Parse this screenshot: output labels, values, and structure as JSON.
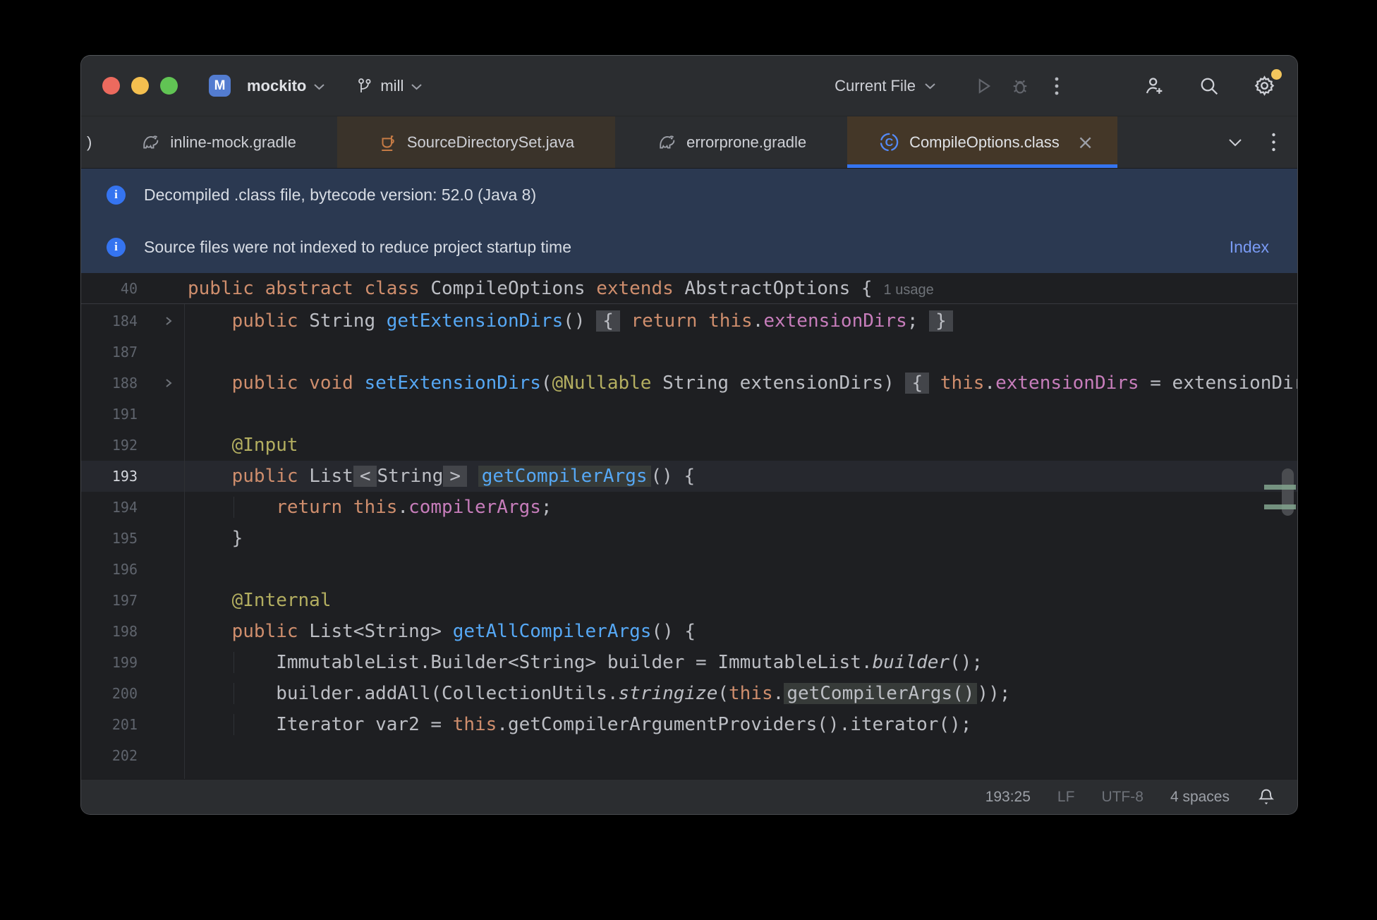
{
  "titlebar": {
    "project_initial": "M",
    "project": "mockito",
    "branch": "mill",
    "run_config": "Current File"
  },
  "tabs": {
    "overflow_left": ")",
    "items": [
      {
        "label": "inline-mock.gradle",
        "icon": "gradle-icon",
        "state": "normal"
      },
      {
        "label": "SourceDirectorySet.java",
        "icon": "java-icon",
        "state": "library"
      },
      {
        "label": "errorprone.gradle",
        "icon": "gradle-icon",
        "state": "normal"
      },
      {
        "label": "CompileOptions.class",
        "icon": "class-icon",
        "state": "active",
        "close": "×"
      }
    ]
  },
  "banners": [
    {
      "icon": "info-icon",
      "text": "Decompiled .class file, bytecode version: 52.0 (Java 8)",
      "action": ""
    },
    {
      "icon": "info-icon",
      "text": "Source files were not indexed to reduce project startup time",
      "action": "Index"
    }
  ],
  "editor": {
    "sticky": {
      "num": "40",
      "segs": [
        [
          "kw",
          "public abstract class "
        ],
        [
          "tx",
          "CompileOptions "
        ],
        [
          "kw",
          "extends "
        ],
        [
          "tx",
          "AbstractOptions {"
        ],
        [
          "inlay",
          "1 usage"
        ]
      ]
    },
    "lines": [
      {
        "num": "184",
        "fold": true,
        "segs": [
          [
            "kw",
            "    public "
          ],
          [
            "tx",
            "String "
          ],
          [
            "m",
            "getExtensionDirs"
          ],
          [
            "tx",
            "() "
          ],
          [
            "box",
            "{"
          ],
          [
            "tx",
            " "
          ],
          [
            "kw",
            "return this"
          ],
          [
            "tx",
            "."
          ],
          [
            "f",
            "extensionDirs"
          ],
          [
            "tx",
            "; "
          ],
          [
            "box",
            "}"
          ]
        ]
      },
      {
        "num": "187",
        "segs": []
      },
      {
        "num": "188",
        "fold": true,
        "segs": [
          [
            "kw",
            "    public void "
          ],
          [
            "m",
            "setExtensionDirs"
          ],
          [
            "tx",
            "("
          ],
          [
            "ann",
            "@Nullable"
          ],
          [
            "tx",
            " String extensionDirs) "
          ],
          [
            "box",
            "{"
          ],
          [
            "tx",
            " "
          ],
          [
            "kw",
            "this"
          ],
          [
            "tx",
            "."
          ],
          [
            "f",
            "extensionDirs"
          ],
          [
            "tx",
            " = extensionDirs"
          ]
        ]
      },
      {
        "num": "191",
        "segs": []
      },
      {
        "num": "192",
        "segs": [
          [
            "ann",
            "    @Input"
          ]
        ]
      },
      {
        "num": "193",
        "current": true,
        "segs": [
          [
            "kw",
            "    public "
          ],
          [
            "tx",
            "List"
          ],
          [
            "box",
            "<"
          ],
          [
            "tx",
            "String"
          ],
          [
            "box",
            ">"
          ],
          [
            "tx",
            " "
          ],
          [
            "usem",
            "getCompilerArgs"
          ],
          [
            "tx",
            "() {"
          ]
        ]
      },
      {
        "num": "194",
        "guide": true,
        "segs": [
          [
            "kw",
            "        return this"
          ],
          [
            "tx",
            "."
          ],
          [
            "f",
            "compilerArgs"
          ],
          [
            "tx",
            ";"
          ]
        ]
      },
      {
        "num": "195",
        "segs": [
          [
            "tx",
            "    }"
          ]
        ]
      },
      {
        "num": "196",
        "segs": []
      },
      {
        "num": "197",
        "segs": [
          [
            "ann",
            "    @Internal"
          ]
        ]
      },
      {
        "num": "198",
        "segs": [
          [
            "kw",
            "    public "
          ],
          [
            "tx",
            "List<String> "
          ],
          [
            "m",
            "getAllCompilerArgs"
          ],
          [
            "tx",
            "() {"
          ]
        ]
      },
      {
        "num": "199",
        "guide": true,
        "segs": [
          [
            "tx",
            "        ImmutableList.Builder<String> builder = ImmutableList."
          ],
          [
            "it",
            "builder"
          ],
          [
            "tx",
            "();"
          ]
        ]
      },
      {
        "num": "200",
        "guide": true,
        "segs": [
          [
            "tx",
            "        builder.addAll(CollectionUtils."
          ],
          [
            "it",
            "stringize"
          ],
          [
            "tx",
            "("
          ],
          [
            "kw",
            "this"
          ],
          [
            "tx",
            "."
          ],
          [
            "use",
            "getCompilerArgs()"
          ],
          [
            "tx",
            "));"
          ]
        ]
      },
      {
        "num": "201",
        "guide": true,
        "segs": [
          [
            "tx",
            "        Iterator var2 = "
          ],
          [
            "kw",
            "this"
          ],
          [
            "tx",
            ".getCompilerArgumentProviders().iterator();"
          ]
        ]
      },
      {
        "num": "202",
        "segs": []
      }
    ]
  },
  "statusbar": {
    "caret": "193:25",
    "line_ending": "LF",
    "encoding": "UTF-8",
    "indent": "4 spaces"
  },
  "colors": {
    "accent_blue": "#3574f0",
    "banner_bg": "#2b3951",
    "editor_bg": "#1e1f22",
    "chrome_bg": "#2b2d30",
    "keyword": "#cf8e6d",
    "method": "#56a8f5",
    "field": "#c77dbb",
    "annotation": "#b3ae60",
    "gear_badge": "#f2c55c"
  }
}
